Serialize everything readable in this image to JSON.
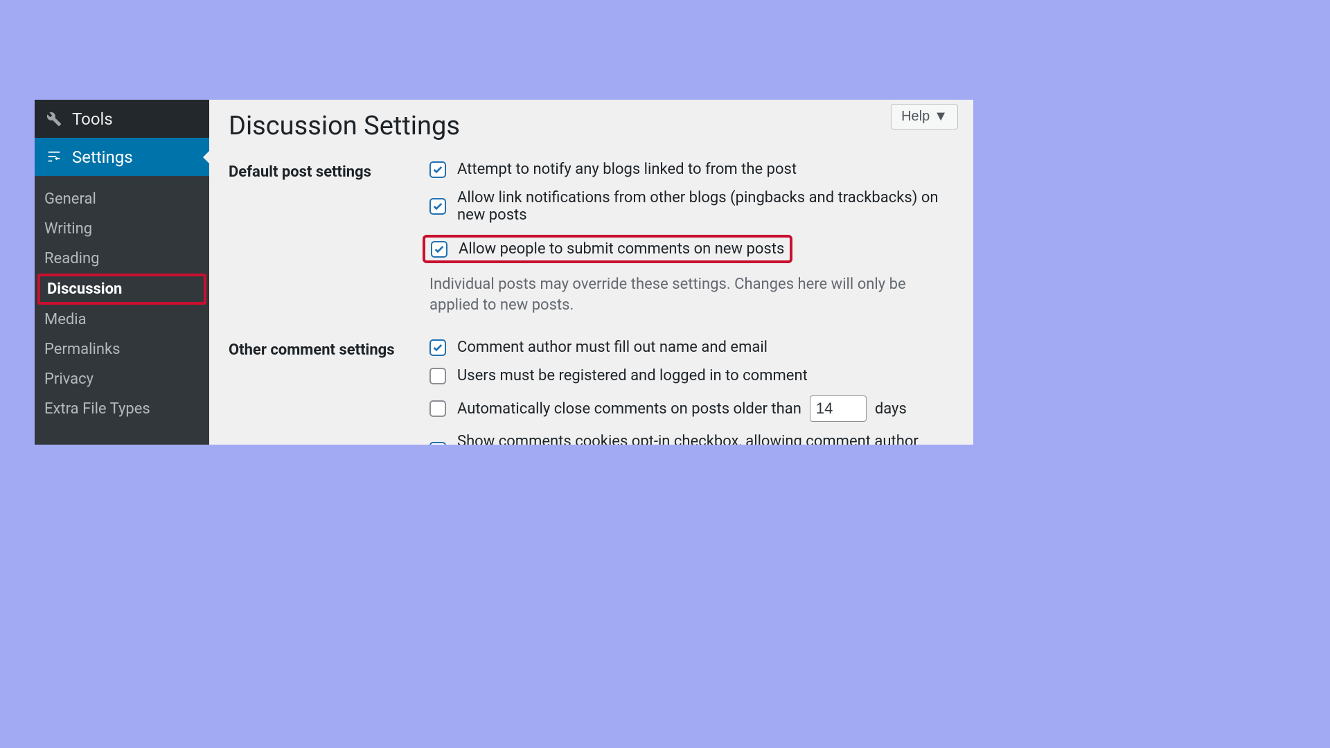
{
  "sidebar": {
    "tools": {
      "label": "Tools"
    },
    "settings": {
      "label": "Settings"
    },
    "sub": [
      {
        "label": "General"
      },
      {
        "label": "Writing"
      },
      {
        "label": "Reading"
      },
      {
        "label": "Discussion"
      },
      {
        "label": "Media"
      },
      {
        "label": "Permalinks"
      },
      {
        "label": "Privacy"
      },
      {
        "label": "Extra File Types"
      }
    ]
  },
  "page": {
    "title": "Discussion Settings",
    "help": "Help"
  },
  "default_post": {
    "heading": "Default post settings",
    "opt1": "Attempt to notify any blogs linked to from the post",
    "opt2": "Allow link notifications from other blogs (pingbacks and trackbacks) on new posts",
    "opt3": "Allow people to submit comments on new posts",
    "note": "Individual posts may override these settings. Changes here will only be applied to new posts."
  },
  "other_comment": {
    "heading": "Other comment settings",
    "opt1": "Comment author must fill out name and email",
    "opt2": "Users must be registered and logged in to comment",
    "opt3_pre": "Automatically close comments on posts older than",
    "opt3_days": "14",
    "opt3_post": "days",
    "opt4": "Show comments cookies opt-in checkbox, allowing comment author cookies to be set"
  }
}
